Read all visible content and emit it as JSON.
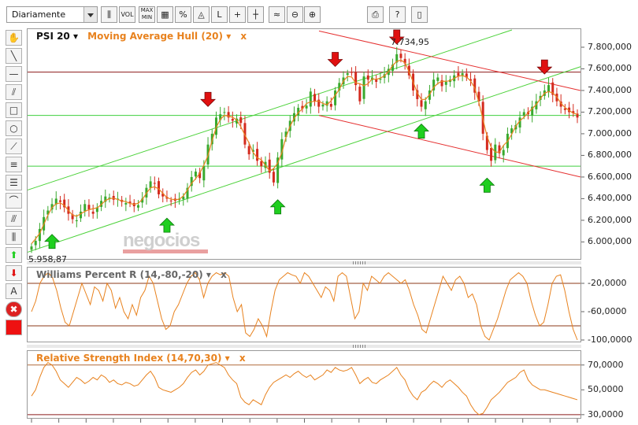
{
  "toolbar": {
    "period": "Diariamente",
    "buttons": [
      {
        "name": "candle-type-icon",
        "label": ""
      },
      {
        "name": "vol-button",
        "label": "VOL"
      },
      {
        "name": "maxmin-button",
        "label": "MAX MIN"
      },
      {
        "name": "grid-icon",
        "label": ""
      },
      {
        "name": "percent-button",
        "label": "%"
      },
      {
        "name": "chart-type-icon",
        "label": ""
      },
      {
        "name": "log-button",
        "label": "L"
      },
      {
        "name": "crosshair-icon",
        "label": ""
      },
      {
        "name": "crosshair2-icon",
        "label": ""
      },
      {
        "name": "compare-icon",
        "label": ""
      },
      {
        "name": "zoom-out-icon",
        "label": ""
      },
      {
        "name": "zoom-in-icon",
        "label": ""
      },
      {
        "name": "print-icon",
        "label": ""
      },
      {
        "name": "help-button",
        "label": "?"
      },
      {
        "name": "book-icon",
        "label": ""
      }
    ]
  },
  "main_legend": {
    "symbol": "PSI 20",
    "indicator": "Moving Average Hull (20)",
    "close_x": "x"
  },
  "wpr_legend": {
    "name": "Williams Percent R (14,-80,-20)",
    "close_x": "x"
  },
  "rsi_legend": {
    "name": "Relative Strength Index (14,70,30)",
    "close_x": "x"
  },
  "watermark": "negocios",
  "colors": {
    "up": "#39a92e",
    "down": "#d42a1e",
    "hull": "#e8821e",
    "osc": "#e8821e",
    "green_line": "#4cd23a",
    "red_line": "#e53030",
    "accent_green": "#1fcf1f",
    "accent_red": "#e01010"
  },
  "chart_data": [
    {
      "type": "candlestick",
      "title": "PSI 20",
      "ylim": [
        5850,
        7960
      ],
      "yticks": [
        "7.800,000",
        "7.600,000",
        "7.400,000",
        "7.200,000",
        "7.000,000",
        "6.800,000",
        "6.600,000",
        "6.400,000",
        "6.200,000",
        "6.000,000"
      ],
      "ytick_values": [
        7800,
        7600,
        7400,
        7200,
        7000,
        6800,
        6600,
        6400,
        6200,
        6000
      ],
      "annotations": [
        {
          "text": "7.734,95",
          "value": 7734.95
        },
        {
          "text": "5.958,87",
          "value": 5958.87
        }
      ],
      "series": [
        {
          "name": "PSI 20",
          "close": [
            5958,
            6010,
            6120,
            6230,
            6290,
            6350,
            6400,
            6370,
            6320,
            6260,
            6210,
            6200,
            6280,
            6350,
            6300,
            6260,
            6320,
            6380,
            6420,
            6410,
            6390,
            6400,
            6370,
            6360,
            6360,
            6330,
            6340,
            6400,
            6500,
            6560,
            6540,
            6440,
            6420,
            6400,
            6380,
            6380,
            6400,
            6420,
            6500,
            6600,
            6650,
            6590,
            6700,
            6900,
            7000,
            7150,
            7180,
            7200,
            7150,
            7120,
            7140,
            7100,
            6900,
            6810,
            6850,
            6750,
            6700,
            6740,
            6640,
            6550,
            6780,
            6950,
            7020,
            7120,
            7190,
            7240,
            7230,
            7260,
            7390,
            7300,
            7250,
            7270,
            7300,
            7250,
            7400,
            7470,
            7520,
            7560,
            7570,
            7450,
            7300,
            7530,
            7500,
            7520,
            7480,
            7510,
            7550,
            7600,
            7640,
            7735,
            7700,
            7650,
            7540,
            7400,
            7320,
            7250,
            7300,
            7400,
            7500,
            7520,
            7440,
            7480,
            7500,
            7540,
            7530,
            7560,
            7520,
            7490,
            7380,
            7300,
            7000,
            6850,
            6750,
            6900,
            6820,
            6850,
            7000,
            7050,
            7080,
            7150,
            7200,
            7180,
            7250,
            7300,
            7350,
            7400,
            7450,
            7360,
            7300,
            7250,
            7220,
            7200,
            7190,
            7150
          ]
        }
      ],
      "hull_ma": {
        "name": "Moving Average Hull (20)"
      },
      "levels": [
        7570,
        7170,
        6700
      ],
      "signals_up": [
        5,
        33,
        60,
        95,
        111
      ],
      "signals_down": [
        43,
        74,
        89,
        125
      ]
    },
    {
      "type": "line",
      "title": "Williams Percent R (14,-80,-20)",
      "ylim": [
        -100,
        0
      ],
      "yticks": [
        "-20,0000",
        "-60,0000",
        "-100,0000"
      ],
      "ytick_values": [
        -20,
        -60,
        -100
      ],
      "levels": [
        -20,
        -80
      ],
      "series": [
        {
          "name": "Williams Percent R (14,-80,-20)",
          "values": [
            -60,
            -45,
            -20,
            -10,
            -5,
            -12,
            -30,
            -55,
            -75,
            -80,
            -60,
            -40,
            -20,
            -35,
            -50,
            -25,
            -30,
            -45,
            -20,
            -30,
            -55,
            -40,
            -60,
            -70,
            -50,
            -65,
            -40,
            -30,
            -10,
            -20,
            -45,
            -70,
            -85,
            -80,
            -60,
            -50,
            -35,
            -20,
            -10,
            -5,
            -15,
            -40,
            -20,
            -10,
            -5,
            -8,
            -5,
            -10,
            -40,
            -60,
            -50,
            -90,
            -95,
            -85,
            -70,
            -80,
            -95,
            -60,
            -30,
            -15,
            -10,
            -5,
            -8,
            -10,
            -20,
            -5,
            -10,
            -20,
            -30,
            -40,
            -25,
            -30,
            -45,
            -10,
            -5,
            -10,
            -40,
            -70,
            -60,
            -20,
            -30,
            -10,
            -15,
            -20,
            -10,
            -5,
            -10,
            -15,
            -20,
            -15,
            -30,
            -50,
            -65,
            -85,
            -90,
            -70,
            -50,
            -30,
            -10,
            -20,
            -30,
            -15,
            -10,
            -20,
            -40,
            -35,
            -50,
            -80,
            -95,
            -100,
            -85,
            -70,
            -50,
            -30,
            -15,
            -10,
            -5,
            -10,
            -20,
            -45,
            -65,
            -80,
            -75,
            -50,
            -20,
            -10,
            -8,
            -30,
            -60,
            -85,
            -100
          ]
        }
      ]
    },
    {
      "type": "line",
      "title": "Relative Strength Index (14,70,30)",
      "ylim": [
        28,
        80
      ],
      "yticks": [
        "70,0000",
        "50,0000",
        "30,0000"
      ],
      "ytick_values": [
        70,
        50,
        30
      ],
      "levels": [
        70,
        30
      ],
      "series": [
        {
          "name": "Relative Strength Index (14,70,30)",
          "values": [
            45,
            50,
            60,
            68,
            72,
            70,
            65,
            58,
            55,
            52,
            56,
            60,
            58,
            55,
            57,
            60,
            58,
            62,
            60,
            56,
            58,
            55,
            54,
            56,
            55,
            53,
            54,
            58,
            62,
            65,
            60,
            52,
            50,
            49,
            48,
            50,
            52,
            55,
            60,
            64,
            66,
            62,
            65,
            70,
            71,
            72,
            70,
            68,
            62,
            58,
            55,
            44,
            40,
            38,
            42,
            40,
            38,
            46,
            52,
            56,
            58,
            60,
            62,
            60,
            63,
            65,
            62,
            60,
            62,
            58,
            60,
            62,
            66,
            64,
            68,
            66,
            65,
            66,
            68,
            62,
            55,
            58,
            60,
            56,
            55,
            58,
            60,
            62,
            65,
            68,
            62,
            58,
            50,
            45,
            42,
            48,
            50,
            54,
            57,
            55,
            52,
            56,
            58,
            55,
            52,
            48,
            45,
            38,
            33,
            30,
            31,
            36,
            42,
            45,
            48,
            52,
            56,
            58,
            60,
            64,
            66,
            58,
            54,
            52,
            50,
            50,
            49,
            48,
            47,
            46,
            45,
            44,
            43,
            42
          ]
        }
      ]
    }
  ]
}
